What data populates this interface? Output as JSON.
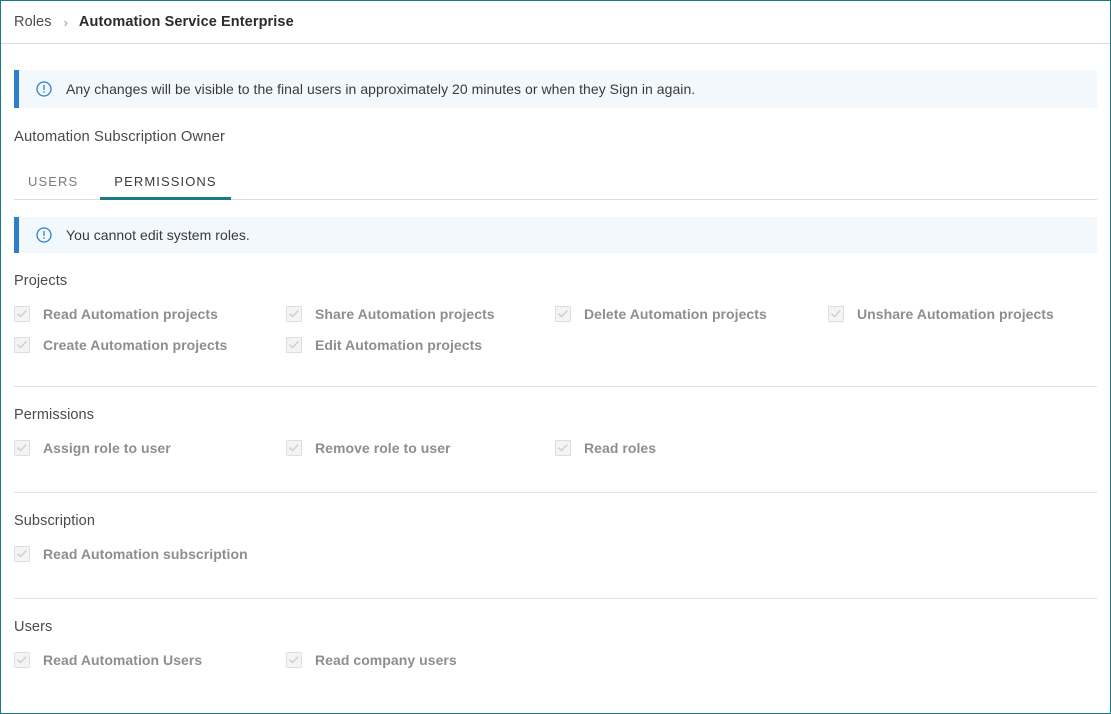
{
  "breadcrumb": {
    "root": "Roles",
    "separator": "›",
    "current": "Automation Service Enterprise"
  },
  "banners": [
    {
      "icon": "info-circle-icon",
      "text": "Any changes will be visible to the final users in approximately 20 minutes or when they Sign in again."
    },
    {
      "icon": "info-circle-icon",
      "text": "You cannot edit system roles."
    }
  ],
  "role": {
    "title": "Automation Subscription Owner"
  },
  "tabs": [
    {
      "label": "USERS",
      "active": false
    },
    {
      "label": "PERMISSIONS",
      "active": true
    }
  ],
  "sections": [
    {
      "title": "Projects",
      "permissions": [
        {
          "label": "Read Automation projects",
          "checked": true,
          "disabled": true
        },
        {
          "label": "Share Automation projects",
          "checked": true,
          "disabled": true
        },
        {
          "label": "Delete Automation projects",
          "checked": true,
          "disabled": true
        },
        {
          "label": "Unshare Automation projects",
          "checked": true,
          "disabled": true
        },
        {
          "label": "Create Automation projects",
          "checked": true,
          "disabled": true
        },
        {
          "label": "Edit Automation projects",
          "checked": true,
          "disabled": true
        }
      ]
    },
    {
      "title": "Permissions",
      "permissions": [
        {
          "label": "Assign role to user",
          "checked": true,
          "disabled": true
        },
        {
          "label": "Remove role to user",
          "checked": true,
          "disabled": true
        },
        {
          "label": "Read roles",
          "checked": true,
          "disabled": true
        }
      ]
    },
    {
      "title": "Subscription",
      "permissions": [
        {
          "label": "Read Automation subscription",
          "checked": true,
          "disabled": true
        }
      ]
    },
    {
      "title": "Users",
      "permissions": [
        {
          "label": "Read Automation Users",
          "checked": true,
          "disabled": true
        },
        {
          "label": "Read company users",
          "checked": true,
          "disabled": true
        }
      ]
    }
  ],
  "colors": {
    "frame_border": "#1b7b84",
    "tab_active": "#1b7b84",
    "banner_bar": "#2b7fd1",
    "banner_bg": "#f3f8fc",
    "divider": "#e2e2e2",
    "label_text": "#8e8e8e"
  }
}
